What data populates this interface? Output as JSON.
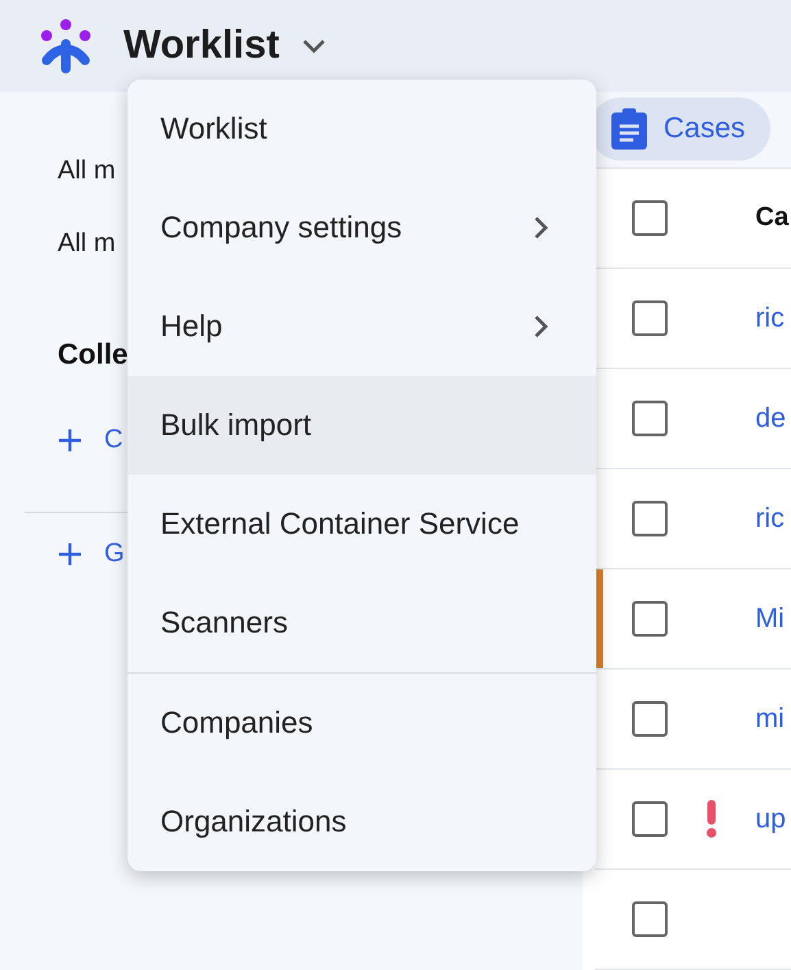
{
  "header": {
    "title": "Worklist"
  },
  "sidebar": {
    "items": [
      {
        "label": "All m"
      },
      {
        "label": "All m"
      }
    ],
    "section_title": "Colle",
    "actions": [
      {
        "label": "C"
      },
      {
        "label": "G"
      }
    ]
  },
  "view_chip": {
    "label": "Cases",
    "selected": true
  },
  "table": {
    "select_all": {
      "checked": false
    },
    "columns": [
      "Ca"
    ],
    "rows": [
      {
        "cell": "ric",
        "checked": false,
        "highlighted": false,
        "alert": false
      },
      {
        "cell": "de",
        "checked": false,
        "highlighted": false,
        "alert": false
      },
      {
        "cell": "ric",
        "checked": false,
        "highlighted": false,
        "alert": false
      },
      {
        "cell": "Mi",
        "checked": false,
        "highlighted": true,
        "alert": false
      },
      {
        "cell": "mi",
        "checked": false,
        "highlighted": false,
        "alert": false
      },
      {
        "cell": "up",
        "checked": false,
        "highlighted": false,
        "alert": true
      },
      {
        "checked": false,
        "highlighted": false,
        "alert": false
      }
    ]
  },
  "menu": {
    "sections": [
      [
        {
          "label": "Worklist",
          "submenu": false,
          "hovered": false
        },
        {
          "label": "Company settings",
          "submenu": true,
          "hovered": false
        },
        {
          "label": "Help",
          "submenu": true,
          "hovered": false
        },
        {
          "label": "Bulk import",
          "submenu": false,
          "hovered": true
        },
        {
          "label": "External Container Service",
          "submenu": false,
          "hovered": false
        },
        {
          "label": "Scanners",
          "submenu": false,
          "hovered": false
        }
      ],
      [
        {
          "label": "Companies",
          "submenu": false,
          "hovered": false
        },
        {
          "label": "Organizations",
          "submenu": false,
          "hovered": false
        }
      ]
    ]
  }
}
